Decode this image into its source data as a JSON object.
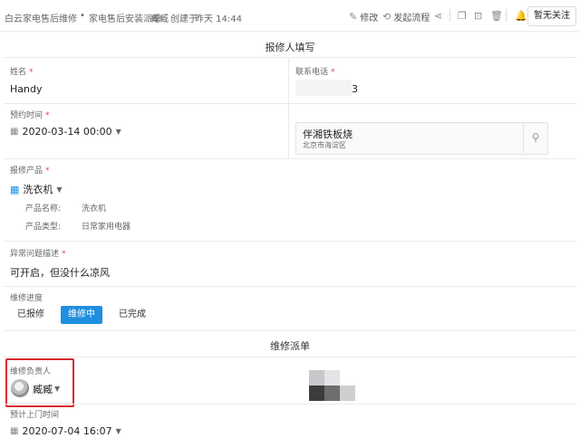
{
  "breadcrumb": {
    "app": "白云家电售后维修",
    "separator": "•",
    "form": "家电售后安装派单",
    "creator": "臧臧",
    "created_label": "创建于",
    "created_time": "昨天 14:44"
  },
  "toolbar": {
    "edit_label": "修改",
    "flow_label": "发起流程",
    "follow_label": "暂无关注"
  },
  "section1": {
    "title": "报修人填写"
  },
  "fields": {
    "name": {
      "label": "姓名",
      "required": "*",
      "value": "Handy"
    },
    "phone": {
      "label": "联系电话",
      "required": "*",
      "value": "3"
    },
    "appointment": {
      "label": "预约时间",
      "required": "*",
      "value": "2020-03-14 00:00"
    },
    "address": {
      "title": "伴湘铁板烧",
      "subtitle": "北京市海淀区"
    },
    "product": {
      "label": "报修产品",
      "required": "*",
      "value": "洗衣机",
      "name_label": "产品名称:",
      "name_value": "洗衣机",
      "type_label": "产品类型:",
      "type_value": "日常家用电器"
    },
    "issue": {
      "label": "异常问题描述",
      "required": "*",
      "value": "可开启，但没什么凉风"
    },
    "progress": {
      "label": "维修进度",
      "options": [
        "已报修",
        "维修中",
        "已完成"
      ],
      "selected": "维修中"
    }
  },
  "section2": {
    "title": "维修派单"
  },
  "dispatch": {
    "owner_label": "维修负责人",
    "owner_value": "臧臧",
    "eta_label": "预计上门时间",
    "eta_value": "2020-07-04 16:07"
  },
  "colors": {
    "accent": "#1f8ee0",
    "required": "#e54545",
    "highlight": "#d92b2b"
  },
  "icons": [
    "edit-icon",
    "flow-icon",
    "share-icon",
    "copy-icon",
    "lock-icon",
    "delete-icon",
    "bell-icon",
    "calendar-icon",
    "location-pin-icon",
    "grid-icon",
    "chevron-down-icon"
  ]
}
